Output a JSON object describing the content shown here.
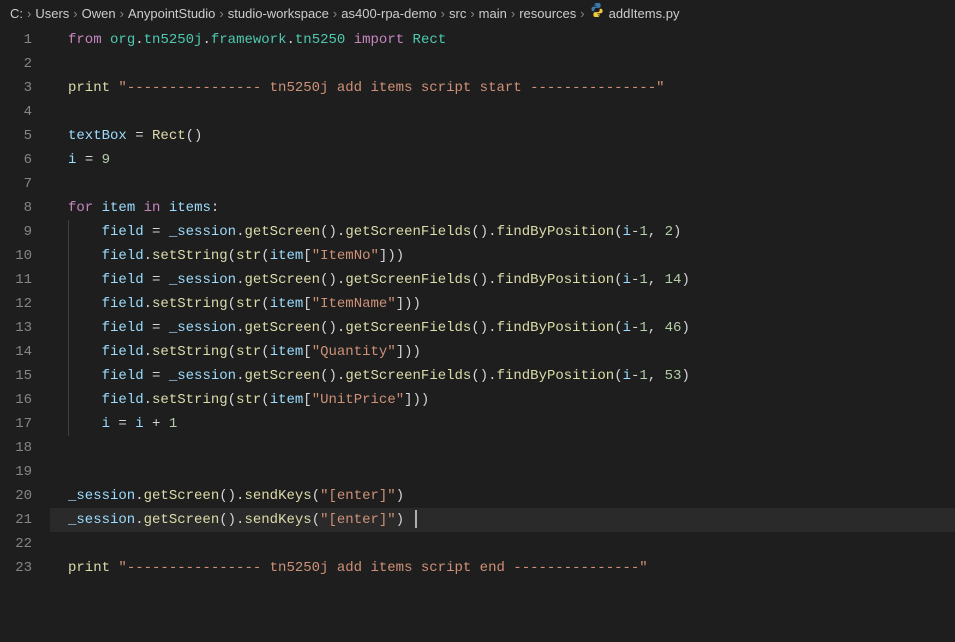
{
  "breadcrumb": {
    "items": [
      "C:",
      "Users",
      "Owen",
      "AnypointStudio",
      "studio-workspace",
      "as400-rpa-demo",
      "src",
      "main",
      "resources"
    ],
    "file": "addItems.py",
    "separator": "›"
  },
  "code": {
    "lines": [
      {
        "n": 1,
        "tokens": [
          {
            "t": "kw",
            "v": "from"
          },
          {
            "t": "sp",
            "v": " "
          },
          {
            "t": "mod",
            "v": "org"
          },
          {
            "t": "punct",
            "v": "."
          },
          {
            "t": "mod",
            "v": "tn5250j"
          },
          {
            "t": "punct",
            "v": "."
          },
          {
            "t": "mod",
            "v": "framework"
          },
          {
            "t": "punct",
            "v": "."
          },
          {
            "t": "mod",
            "v": "tn5250"
          },
          {
            "t": "sp",
            "v": " "
          },
          {
            "t": "kw",
            "v": "import"
          },
          {
            "t": "sp",
            "v": " "
          },
          {
            "t": "mod",
            "v": "Rect"
          }
        ]
      },
      {
        "n": 2,
        "tokens": []
      },
      {
        "n": 3,
        "tokens": [
          {
            "t": "fn",
            "v": "print"
          },
          {
            "t": "sp",
            "v": " "
          },
          {
            "t": "str",
            "v": "\"---------------- tn5250j add items script start ---------------\""
          }
        ]
      },
      {
        "n": 4,
        "tokens": []
      },
      {
        "n": 5,
        "tokens": [
          {
            "t": "var",
            "v": "textBox"
          },
          {
            "t": "sp",
            "v": " "
          },
          {
            "t": "op",
            "v": "="
          },
          {
            "t": "sp",
            "v": " "
          },
          {
            "t": "fn",
            "v": "Rect"
          },
          {
            "t": "punct",
            "v": "()"
          }
        ]
      },
      {
        "n": 6,
        "tokens": [
          {
            "t": "var",
            "v": "i"
          },
          {
            "t": "sp",
            "v": " "
          },
          {
            "t": "op",
            "v": "="
          },
          {
            "t": "sp",
            "v": " "
          },
          {
            "t": "num",
            "v": "9"
          }
        ]
      },
      {
        "n": 7,
        "tokens": []
      },
      {
        "n": 8,
        "tokens": [
          {
            "t": "kw",
            "v": "for"
          },
          {
            "t": "sp",
            "v": " "
          },
          {
            "t": "var",
            "v": "item"
          },
          {
            "t": "sp",
            "v": " "
          },
          {
            "t": "kw",
            "v": "in"
          },
          {
            "t": "sp",
            "v": " "
          },
          {
            "t": "var",
            "v": "items"
          },
          {
            "t": "punct",
            "v": ":"
          }
        ]
      },
      {
        "n": 9,
        "indent": 1,
        "tokens": [
          {
            "t": "var",
            "v": "field"
          },
          {
            "t": "sp",
            "v": " "
          },
          {
            "t": "op",
            "v": "="
          },
          {
            "t": "sp",
            "v": " "
          },
          {
            "t": "var",
            "v": "_session"
          },
          {
            "t": "punct",
            "v": "."
          },
          {
            "t": "fn",
            "v": "getScreen"
          },
          {
            "t": "punct",
            "v": "()."
          },
          {
            "t": "fn",
            "v": "getScreenFields"
          },
          {
            "t": "punct",
            "v": "()."
          },
          {
            "t": "fn",
            "v": "findByPosition"
          },
          {
            "t": "punct",
            "v": "("
          },
          {
            "t": "var",
            "v": "i"
          },
          {
            "t": "op",
            "v": "-"
          },
          {
            "t": "num",
            "v": "1"
          },
          {
            "t": "punct",
            "v": ", "
          },
          {
            "t": "num",
            "v": "2"
          },
          {
            "t": "punct",
            "v": ")"
          }
        ]
      },
      {
        "n": 10,
        "indent": 1,
        "tokens": [
          {
            "t": "var",
            "v": "field"
          },
          {
            "t": "punct",
            "v": "."
          },
          {
            "t": "fn",
            "v": "setString"
          },
          {
            "t": "punct",
            "v": "("
          },
          {
            "t": "fn",
            "v": "str"
          },
          {
            "t": "punct",
            "v": "("
          },
          {
            "t": "var",
            "v": "item"
          },
          {
            "t": "punct",
            "v": "["
          },
          {
            "t": "str",
            "v": "\"ItemNo\""
          },
          {
            "t": "punct",
            "v": "]))"
          }
        ]
      },
      {
        "n": 11,
        "indent": 1,
        "tokens": [
          {
            "t": "var",
            "v": "field"
          },
          {
            "t": "sp",
            "v": " "
          },
          {
            "t": "op",
            "v": "="
          },
          {
            "t": "sp",
            "v": " "
          },
          {
            "t": "var",
            "v": "_session"
          },
          {
            "t": "punct",
            "v": "."
          },
          {
            "t": "fn",
            "v": "getScreen"
          },
          {
            "t": "punct",
            "v": "()."
          },
          {
            "t": "fn",
            "v": "getScreenFields"
          },
          {
            "t": "punct",
            "v": "()."
          },
          {
            "t": "fn",
            "v": "findByPosition"
          },
          {
            "t": "punct",
            "v": "("
          },
          {
            "t": "var",
            "v": "i"
          },
          {
            "t": "op",
            "v": "-"
          },
          {
            "t": "num",
            "v": "1"
          },
          {
            "t": "punct",
            "v": ", "
          },
          {
            "t": "num",
            "v": "14"
          },
          {
            "t": "punct",
            "v": ")"
          }
        ]
      },
      {
        "n": 12,
        "indent": 1,
        "tokens": [
          {
            "t": "var",
            "v": "field"
          },
          {
            "t": "punct",
            "v": "."
          },
          {
            "t": "fn",
            "v": "setString"
          },
          {
            "t": "punct",
            "v": "("
          },
          {
            "t": "fn",
            "v": "str"
          },
          {
            "t": "punct",
            "v": "("
          },
          {
            "t": "var",
            "v": "item"
          },
          {
            "t": "punct",
            "v": "["
          },
          {
            "t": "str",
            "v": "\"ItemName\""
          },
          {
            "t": "punct",
            "v": "]))"
          }
        ]
      },
      {
        "n": 13,
        "indent": 1,
        "tokens": [
          {
            "t": "var",
            "v": "field"
          },
          {
            "t": "sp",
            "v": " "
          },
          {
            "t": "op",
            "v": "="
          },
          {
            "t": "sp",
            "v": " "
          },
          {
            "t": "var",
            "v": "_session"
          },
          {
            "t": "punct",
            "v": "."
          },
          {
            "t": "fn",
            "v": "getScreen"
          },
          {
            "t": "punct",
            "v": "()."
          },
          {
            "t": "fn",
            "v": "getScreenFields"
          },
          {
            "t": "punct",
            "v": "()."
          },
          {
            "t": "fn",
            "v": "findByPosition"
          },
          {
            "t": "punct",
            "v": "("
          },
          {
            "t": "var",
            "v": "i"
          },
          {
            "t": "op",
            "v": "-"
          },
          {
            "t": "num",
            "v": "1"
          },
          {
            "t": "punct",
            "v": ", "
          },
          {
            "t": "num",
            "v": "46"
          },
          {
            "t": "punct",
            "v": ")"
          }
        ]
      },
      {
        "n": 14,
        "indent": 1,
        "tokens": [
          {
            "t": "var",
            "v": "field"
          },
          {
            "t": "punct",
            "v": "."
          },
          {
            "t": "fn",
            "v": "setString"
          },
          {
            "t": "punct",
            "v": "("
          },
          {
            "t": "fn",
            "v": "str"
          },
          {
            "t": "punct",
            "v": "("
          },
          {
            "t": "var",
            "v": "item"
          },
          {
            "t": "punct",
            "v": "["
          },
          {
            "t": "str",
            "v": "\"Quantity\""
          },
          {
            "t": "punct",
            "v": "]))"
          }
        ]
      },
      {
        "n": 15,
        "indent": 1,
        "tokens": [
          {
            "t": "var",
            "v": "field"
          },
          {
            "t": "sp",
            "v": " "
          },
          {
            "t": "op",
            "v": "="
          },
          {
            "t": "sp",
            "v": " "
          },
          {
            "t": "var",
            "v": "_session"
          },
          {
            "t": "punct",
            "v": "."
          },
          {
            "t": "fn",
            "v": "getScreen"
          },
          {
            "t": "punct",
            "v": "()."
          },
          {
            "t": "fn",
            "v": "getScreenFields"
          },
          {
            "t": "punct",
            "v": "()."
          },
          {
            "t": "fn",
            "v": "findByPosition"
          },
          {
            "t": "punct",
            "v": "("
          },
          {
            "t": "var",
            "v": "i"
          },
          {
            "t": "op",
            "v": "-"
          },
          {
            "t": "num",
            "v": "1"
          },
          {
            "t": "punct",
            "v": ", "
          },
          {
            "t": "num",
            "v": "53"
          },
          {
            "t": "punct",
            "v": ")"
          }
        ]
      },
      {
        "n": 16,
        "indent": 1,
        "tokens": [
          {
            "t": "var",
            "v": "field"
          },
          {
            "t": "punct",
            "v": "."
          },
          {
            "t": "fn",
            "v": "setString"
          },
          {
            "t": "punct",
            "v": "("
          },
          {
            "t": "fn",
            "v": "str"
          },
          {
            "t": "punct",
            "v": "("
          },
          {
            "t": "var",
            "v": "item"
          },
          {
            "t": "punct",
            "v": "["
          },
          {
            "t": "str",
            "v": "\"UnitPrice\""
          },
          {
            "t": "punct",
            "v": "]))"
          }
        ]
      },
      {
        "n": 17,
        "indent": 1,
        "tokens": [
          {
            "t": "var",
            "v": "i"
          },
          {
            "t": "sp",
            "v": " "
          },
          {
            "t": "op",
            "v": "="
          },
          {
            "t": "sp",
            "v": " "
          },
          {
            "t": "var",
            "v": "i"
          },
          {
            "t": "sp",
            "v": " "
          },
          {
            "t": "op",
            "v": "+"
          },
          {
            "t": "sp",
            "v": " "
          },
          {
            "t": "num",
            "v": "1"
          }
        ]
      },
      {
        "n": 18,
        "tokens": []
      },
      {
        "n": 19,
        "tokens": []
      },
      {
        "n": 20,
        "tokens": [
          {
            "t": "var",
            "v": "_session"
          },
          {
            "t": "punct",
            "v": "."
          },
          {
            "t": "fn",
            "v": "getScreen"
          },
          {
            "t": "punct",
            "v": "()."
          },
          {
            "t": "fn",
            "v": "sendKeys"
          },
          {
            "t": "punct",
            "v": "("
          },
          {
            "t": "str",
            "v": "\"[enter]\""
          },
          {
            "t": "punct",
            "v": ")"
          }
        ]
      },
      {
        "n": 21,
        "current": true,
        "tokens": [
          {
            "t": "var",
            "v": "_session"
          },
          {
            "t": "punct",
            "v": "."
          },
          {
            "t": "fn",
            "v": "getScreen"
          },
          {
            "t": "punct",
            "v": "()."
          },
          {
            "t": "fn",
            "v": "sendKeys"
          },
          {
            "t": "punct",
            "v": "("
          },
          {
            "t": "str",
            "v": "\"[enter]\""
          },
          {
            "t": "punct",
            "v": ")"
          },
          {
            "t": "cursor",
            "v": ""
          }
        ]
      },
      {
        "n": 22,
        "tokens": []
      },
      {
        "n": 23,
        "tokens": [
          {
            "t": "fn",
            "v": "print"
          },
          {
            "t": "sp",
            "v": " "
          },
          {
            "t": "str",
            "v": "\"---------------- tn5250j add items script end ---------------\""
          }
        ]
      }
    ]
  }
}
